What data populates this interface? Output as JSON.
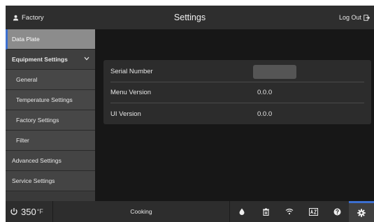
{
  "header": {
    "user_label": "Factory",
    "title": "Settings",
    "logout_label": "Log Out"
  },
  "sidebar": {
    "items": [
      {
        "label": "Data Plate",
        "selected": true
      },
      {
        "label": "Equipment Settings",
        "expanded": true
      },
      {
        "label": "General"
      },
      {
        "label": "Temperature Settings"
      },
      {
        "label": "Factory Settings"
      },
      {
        "label": "Filter"
      },
      {
        "label": "Advanced Settings"
      },
      {
        "label": "Service Settings"
      }
    ]
  },
  "data_plate": {
    "serial_label": "Serial Number",
    "serial_value": "",
    "menu_label": "Menu Version",
    "menu_value": "0.0.0",
    "ui_label": "UI Version",
    "ui_value": "0.0.0"
  },
  "footer": {
    "temperature": "350",
    "temperature_unit": "°F",
    "status": "Cooking",
    "icons": [
      "drop-icon",
      "clean-icon",
      "wifi-icon",
      "a2z-icon",
      "help-icon",
      "settings-gear-icon"
    ]
  },
  "colors": {
    "accent": "#3c6fd0",
    "header_bg": "#2e2e2e",
    "selected_bg": "#8c8c8c"
  }
}
